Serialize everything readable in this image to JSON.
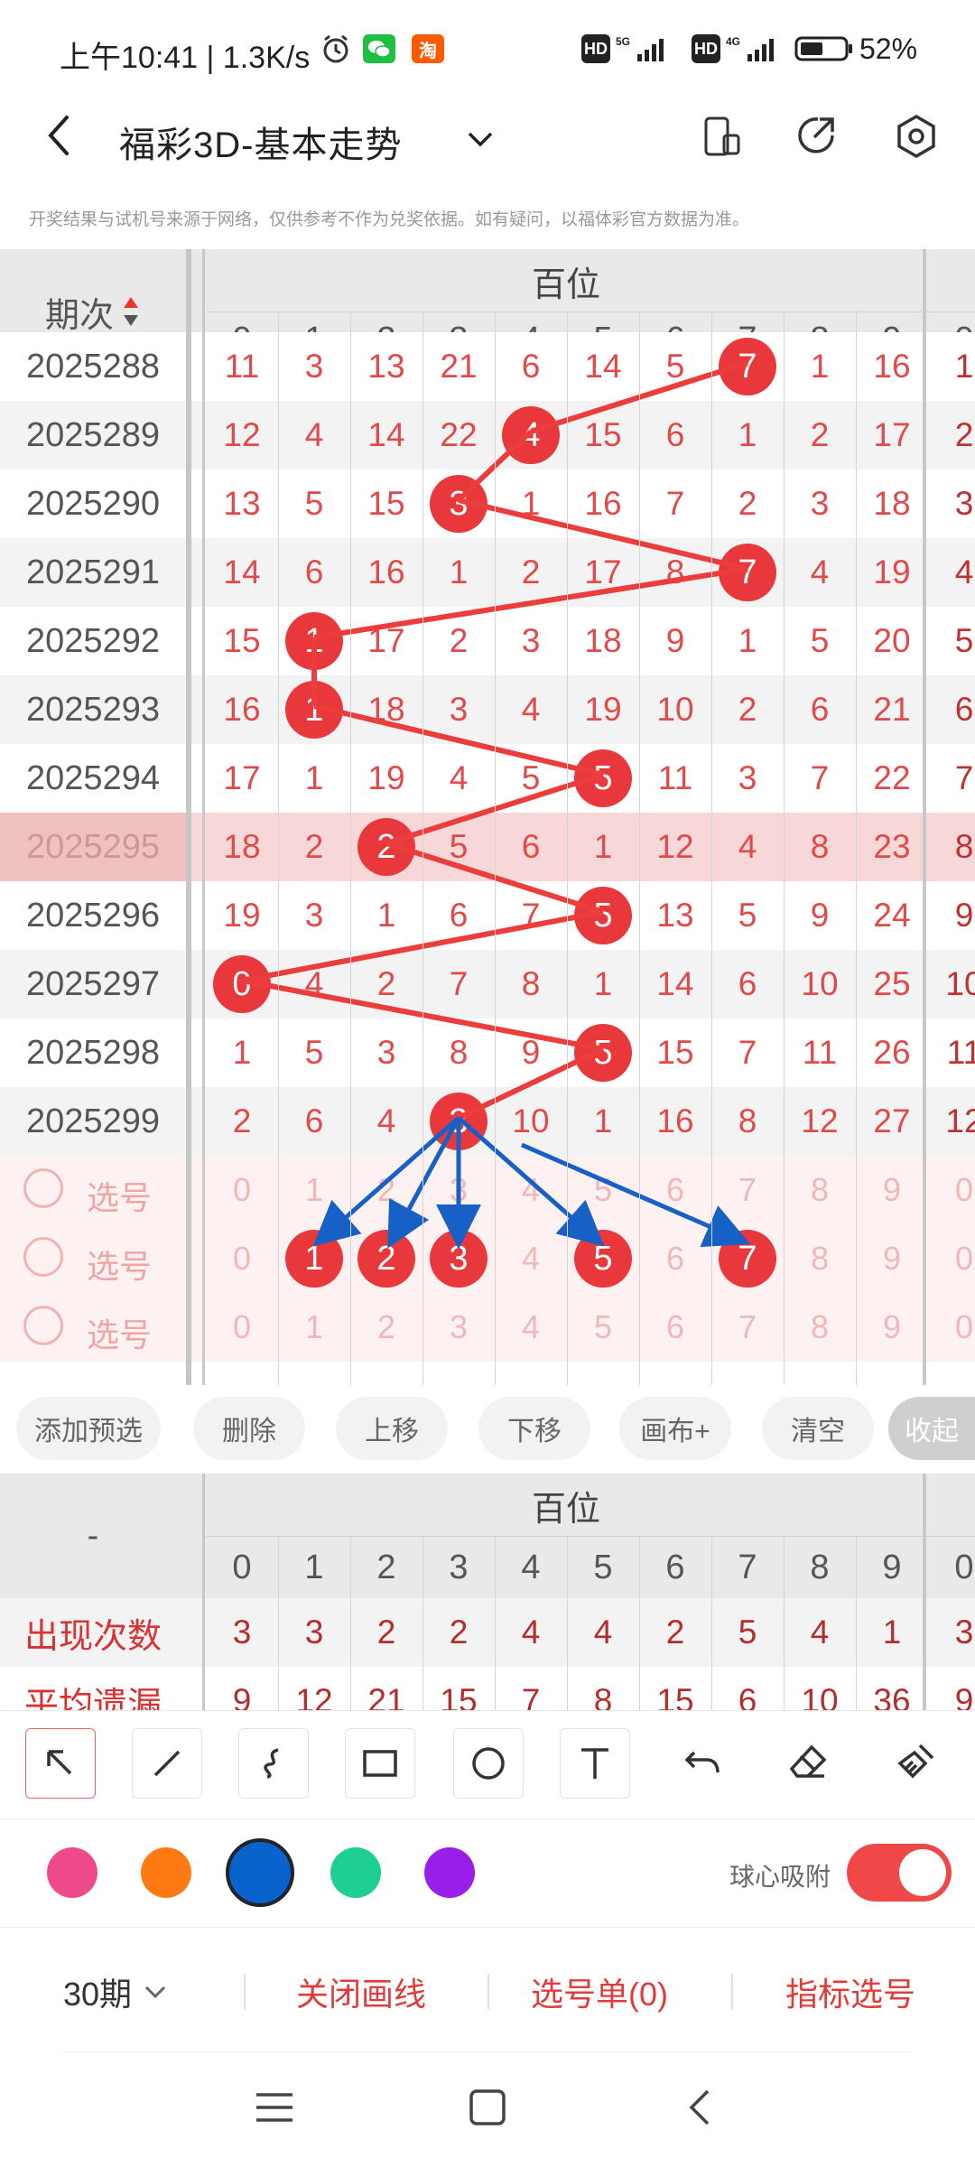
{
  "status_bar": {
    "time": "上午10:41 | 1.3K/s",
    "icons": [
      "alarm-icon",
      "wechat-icon",
      "taobao-icon",
      "hd-icon",
      "signal-5g-icon",
      "hd-icon",
      "signal-4g-icon",
      "battery-icon"
    ],
    "battery": "52%"
  },
  "header": {
    "title": "福彩3D-基本走势",
    "icons": [
      "back-icon",
      "chevron-down-icon",
      "portrait-icon",
      "share-icon",
      "settings-icon"
    ]
  },
  "notice": "开奖结果与试机号来源于网络，仅供参考不作为兑奖依据。如有疑问，以福体彩官方数据为准。",
  "grid": {
    "period_header": "期次",
    "section_label": "百位",
    "digits": [
      "0",
      "1",
      "2",
      "3",
      "4",
      "5",
      "6",
      "7",
      "8",
      "9"
    ],
    "extra_col_label": "0",
    "rows": [
      {
        "period": "2025288",
        "cells": [
          "11",
          "3",
          "13",
          "21",
          "6",
          "14",
          "5",
          "7",
          "1",
          "16"
        ],
        "ball": 7,
        "extra": "1"
      },
      {
        "period": "2025289",
        "cells": [
          "12",
          "4",
          "14",
          "22",
          "4",
          "15",
          "6",
          "1",
          "2",
          "17"
        ],
        "ball": 4,
        "extra": "2"
      },
      {
        "period": "2025290",
        "cells": [
          "13",
          "5",
          "15",
          "3",
          "1",
          "16",
          "7",
          "2",
          "3",
          "18"
        ],
        "ball": 3,
        "extra": "3"
      },
      {
        "period": "2025291",
        "cells": [
          "14",
          "6",
          "16",
          "1",
          "2",
          "17",
          "8",
          "7",
          "4",
          "19"
        ],
        "ball": 7,
        "extra": "4"
      },
      {
        "period": "2025292",
        "cells": [
          "15",
          "1",
          "17",
          "2",
          "3",
          "18",
          "9",
          "1",
          "5",
          "20"
        ],
        "ball": 1,
        "extra": "5"
      },
      {
        "period": "2025293",
        "cells": [
          "16",
          "1",
          "18",
          "3",
          "4",
          "19",
          "10",
          "2",
          "6",
          "21"
        ],
        "ball": 1,
        "extra": "6"
      },
      {
        "period": "2025294",
        "cells": [
          "17",
          "1",
          "19",
          "4",
          "5",
          "5",
          "11",
          "3",
          "7",
          "22"
        ],
        "ball": 5,
        "extra": "7"
      },
      {
        "period": "2025295",
        "cells": [
          "18",
          "2",
          "2",
          "5",
          "6",
          "1",
          "12",
          "4",
          "8",
          "23"
        ],
        "ball": 2,
        "extra": "8"
      },
      {
        "period": "2025296",
        "cells": [
          "19",
          "3",
          "1",
          "6",
          "7",
          "5",
          "13",
          "5",
          "9",
          "24"
        ],
        "ball": 5,
        "extra": "9"
      },
      {
        "period": "2025297",
        "cells": [
          "0",
          "4",
          "2",
          "7",
          "8",
          "1",
          "14",
          "6",
          "10",
          "25"
        ],
        "ball": 0,
        "extra": "10"
      },
      {
        "period": "2025298",
        "cells": [
          "1",
          "5",
          "3",
          "8",
          "9",
          "5",
          "15",
          "7",
          "11",
          "26"
        ],
        "ball": 5,
        "extra": "11"
      },
      {
        "period": "2025299",
        "cells": [
          "2",
          "6",
          "4",
          "3",
          "10",
          "1",
          "16",
          "8",
          "12",
          "27"
        ],
        "ball": 3,
        "extra": "12"
      }
    ],
    "pick_label": "选号",
    "pick_rows": [
      {
        "selected": []
      },
      {
        "selected": [
          1,
          2,
          3,
          5,
          7
        ]
      },
      {
        "selected": []
      }
    ]
  },
  "toolbar": {
    "buttons": [
      "添加预选",
      "删除",
      "上移",
      "下移",
      "画布+",
      "清空",
      "收起"
    ]
  },
  "stats": {
    "dash": "-",
    "section_label": "百位",
    "rows": [
      {
        "label": "出现次数",
        "values": [
          "3",
          "3",
          "2",
          "2",
          "4",
          "4",
          "2",
          "5",
          "4",
          "1"
        ],
        "extra": "3"
      },
      {
        "label": "平均遗漏",
        "values": [
          "9",
          "12",
          "21",
          "15",
          "7",
          "8",
          "15",
          "6",
          "10",
          "36"
        ],
        "extra": "9"
      }
    ]
  },
  "draw_tools": [
    "pointer-icon",
    "line-icon",
    "curve-icon",
    "rectangle-icon",
    "circle-icon",
    "text-icon",
    "undo-icon",
    "eraser-icon",
    "clear-brush-icon"
  ],
  "colors": [
    "#ee4a8a",
    "#ff7a12",
    "#0a62cc",
    "#1dcf94",
    "#9a1eea"
  ],
  "ball_snap_label": "球心吸附",
  "bottom": {
    "periods": "30期",
    "close_lines": "关闭画线",
    "pick_list": "选号单(0)",
    "indicator_pick": "指标选号"
  }
}
